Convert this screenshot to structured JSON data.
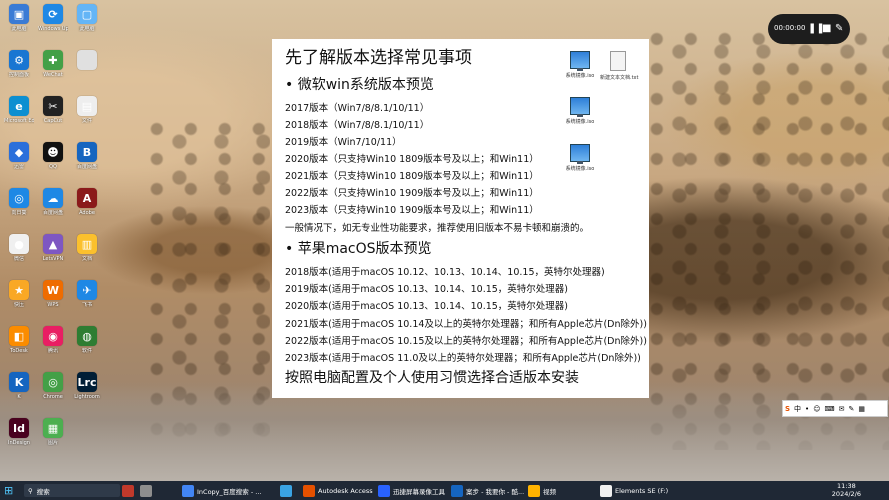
{
  "desktop_icons": [
    {
      "label": "此电脑",
      "color": "#3a7bd5",
      "glyph": "▣"
    },
    {
      "label": "Windows Update",
      "color": "#1e88e5",
      "glyph": "⟳"
    },
    {
      "label": "此电脑",
      "color": "#64b5f6",
      "glyph": "▢"
    },
    {
      "label": "控制面板",
      "color": "#1976d2",
      "glyph": "⚙"
    },
    {
      "label": "WeChat",
      "color": "#43a047",
      "glyph": "✚"
    },
    {
      "label": "",
      "color": "#e0e0e0",
      "glyph": ""
    },
    {
      "label": "Microsoft Edge",
      "color": "#0c8fd1",
      "glyph": "e"
    },
    {
      "label": "CapCut",
      "color": "#222222",
      "glyph": "✂"
    },
    {
      "label": "文件",
      "color": "#eeeeee",
      "glyph": "▤"
    },
    {
      "label": "迅雷",
      "color": "#2a6fdb",
      "glyph": "◆"
    },
    {
      "label": "QQ",
      "color": "#111111",
      "glyph": "☻"
    },
    {
      "label": "百度网盘",
      "color": "#1565c0",
      "glyph": "B"
    },
    {
      "label": "向日葵",
      "color": "#1e88e5",
      "glyph": "◎"
    },
    {
      "label": "百度网盘",
      "color": "#1e88e5",
      "glyph": "☁"
    },
    {
      "label": "Adobe",
      "color": "#8b1a1a",
      "glyph": "A"
    },
    {
      "label": "微信",
      "color": "#f0f0f0",
      "glyph": "●"
    },
    {
      "label": "LetsVPN",
      "color": "#7e57c2",
      "glyph": "▲"
    },
    {
      "label": "文档",
      "color": "#fbc02d",
      "glyph": "▥"
    },
    {
      "label": "快压",
      "color": "#f9a825",
      "glyph": "★"
    },
    {
      "label": "WPS",
      "color": "#ef6c00",
      "glyph": "W"
    },
    {
      "label": "飞书",
      "color": "#1e88e5",
      "glyph": "✈"
    },
    {
      "label": "ToDesk",
      "color": "#fb8c00",
      "glyph": "◧"
    },
    {
      "label": "腾讯",
      "color": "#e91e63",
      "glyph": "◉"
    },
    {
      "label": "软件",
      "color": "#2e7d32",
      "glyph": "◍"
    },
    {
      "label": "K",
      "color": "#1565c0",
      "glyph": "K"
    },
    {
      "label": "Chrome",
      "color": "#43a047",
      "glyph": "◎"
    },
    {
      "label": "Lightroom",
      "color": "#001e36",
      "glyph": "Lrc"
    },
    {
      "label": "InDesign",
      "color": "#49021f",
      "glyph": "Id"
    },
    {
      "label": "图片",
      "color": "#4caf50",
      "glyph": "▦"
    }
  ],
  "recorder": {
    "time": "00:00:00",
    "pause": "❚❚",
    "stop": "■",
    "pen": "✎"
  },
  "slide": {
    "title": "先了解版本选择常见事项",
    "win_heading": "• 微软win系统版本预览",
    "win_lines": [
      "2017版本（Win7/8/8.1/10/11）",
      "2018版本（Win7/8/8.1/10/11）",
      "2019版本（Win7/10/11）",
      "2020版本（只支持Win10 1809版本号及以上；和Win11）",
      "2021版本（只支持Win10 1809版本号及以上；和Win11）",
      "2022版本（只支持Win10 1909版本号及以上；和Win11）",
      "2023版本（只支持Win10 1909版本号及以上；和Win11）",
      "一般情况下，如无专业性功能要求，推荐使用旧版本不易卡顿和崩溃的。"
    ],
    "mac_heading": "• 苹果macOS版本预览",
    "mac_lines": [
      "2018版本(适用于macOS 10.12、10.13、10.14、10.15，英特尔处理器)",
      "2019版本(适用于macOS 10.13、10.14、10.15，英特尔处理器)",
      "2020版本(适用于macOS 10.13、10.14、10.15，英特尔处理器)",
      "2021版本(适用于macOS 10.14及以上的英特尔处理器；和所有Apple芯片(Dn除外))",
      "2022版本(适用于macOS 10.15及以上的英特尔处理器；和所有Apple芯片(Dn除外))",
      "2023版本(适用于macOS 11.0及以上的英特尔处理器；和所有Apple芯片(Dn除外))"
    ],
    "footer": "按照电脑配置及个人使用习惯选择合适版本安装",
    "files": [
      {
        "label": "系统镜像.iso",
        "type": "pc"
      },
      {
        "label": "新建文本文档.txt",
        "type": "doc"
      },
      {
        "label": "系统镜像.iso",
        "type": "pc"
      },
      {
        "label": "系统镜像.iso",
        "type": "pc"
      }
    ]
  },
  "ime": {
    "items": [
      "S",
      "中",
      "•",
      "☺",
      "⌨",
      "✉",
      "✎",
      "▦"
    ]
  },
  "taskbar": {
    "search_placeholder": "搜索",
    "apps": [
      {
        "label": "",
        "color": "#c0392b"
      },
      {
        "label": "",
        "color": "#8e8e8e"
      },
      {
        "label": "InCopy_百度搜索 - ...",
        "color": "#4285f4"
      },
      {
        "label": "",
        "color": "#3aa3e3"
      },
      {
        "label": "Autodesk Access",
        "color": "#e65100"
      },
      {
        "label": "迅捷屏幕录像工具",
        "color": "#2962ff"
      },
      {
        "label": "案步 - 我要你 - 酷...",
        "color": "#1565c0"
      },
      {
        "label": "视频",
        "color": "#ffb300"
      },
      {
        "label": "Elements SE (F:)",
        "color": "#f0f0f0"
      }
    ],
    "time": "11:38",
    "date": "2024/2/6"
  }
}
